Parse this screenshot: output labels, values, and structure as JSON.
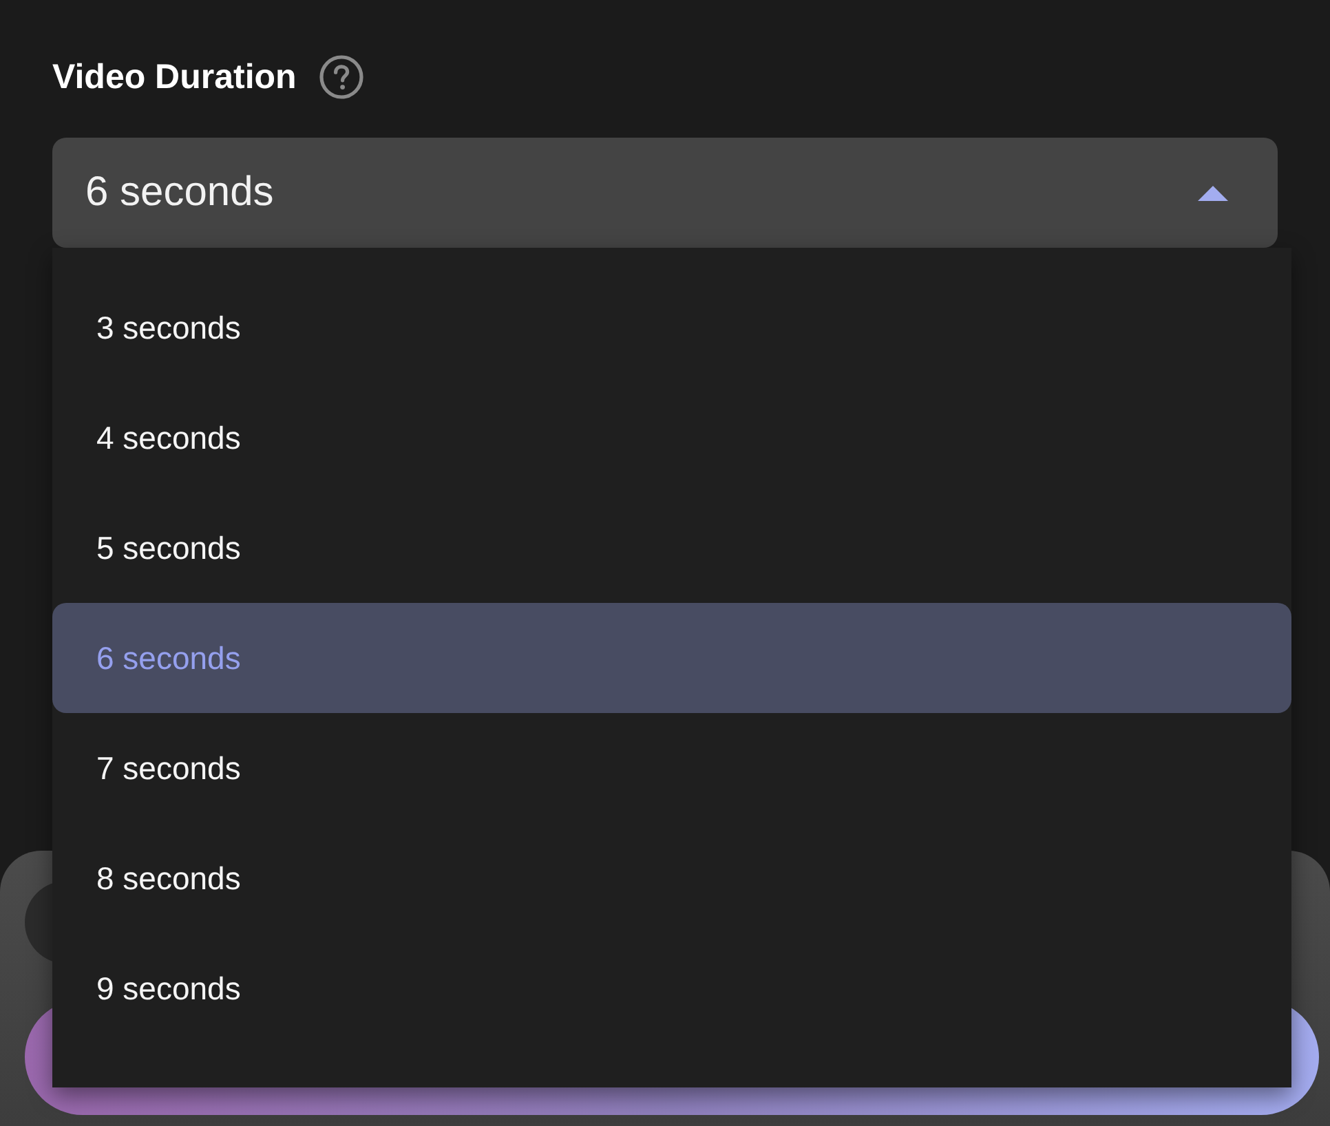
{
  "field": {
    "label": "Video Duration",
    "value": "6 seconds",
    "expanded": true
  },
  "menu": {
    "options": [
      {
        "label": "3 seconds",
        "selected": false
      },
      {
        "label": "4 seconds",
        "selected": false
      },
      {
        "label": "5 seconds",
        "selected": false
      },
      {
        "label": "6 seconds",
        "selected": true
      },
      {
        "label": "7 seconds",
        "selected": false
      },
      {
        "label": "8 seconds",
        "selected": false
      },
      {
        "label": "9 seconds",
        "selected": false
      }
    ]
  }
}
